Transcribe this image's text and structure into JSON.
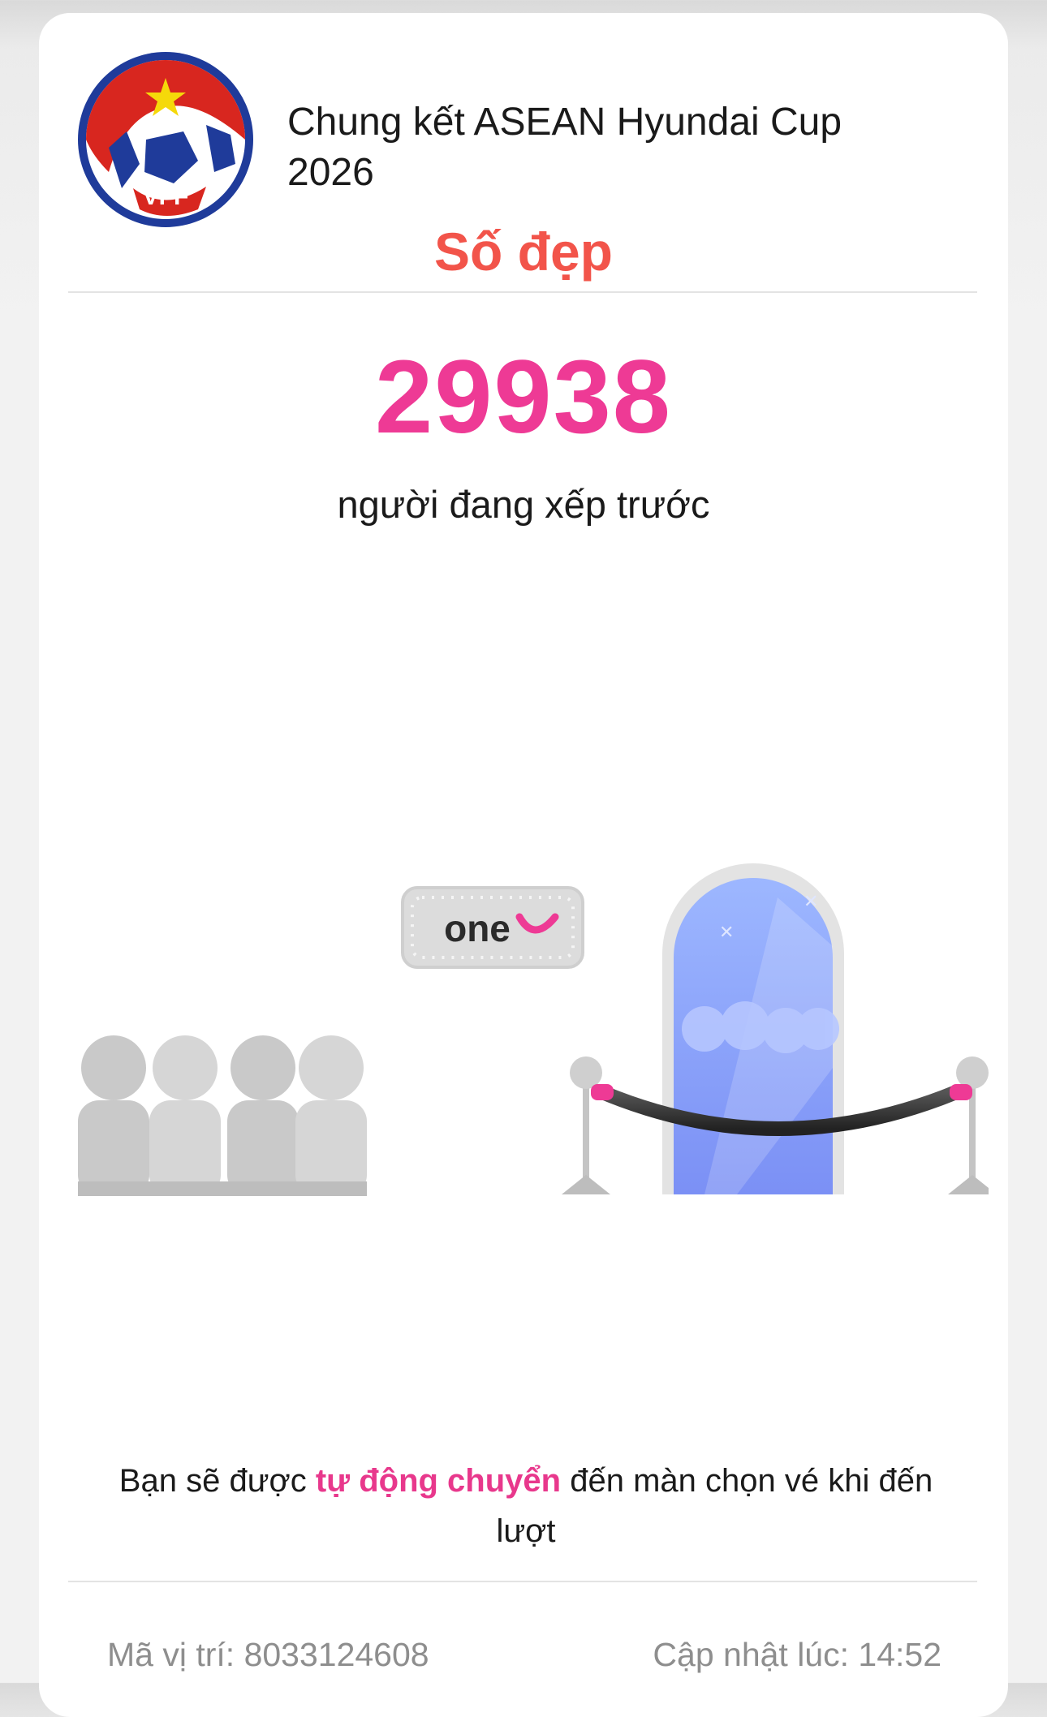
{
  "header": {
    "title": "Chung kết ASEAN Hyundai Cup 2026",
    "subtitle": "Số đẹp",
    "logo_text": "VFF"
  },
  "queue": {
    "ahead_count": "29938",
    "ahead_label": "người đang xếp trước"
  },
  "illustration": {
    "sign_text": "one"
  },
  "notice": {
    "prefix": "Bạn sẽ được ",
    "highlight": "tự động chuyển",
    "suffix": " đến màn chọn vé khi đến lượt"
  },
  "footer": {
    "position_label": "Mã vị trí: 8033124608",
    "updated_label": "Cập nhật lúc: 14:52"
  },
  "colors": {
    "accent_pink": "#ee3a95",
    "subtitle_red": "#f2544a",
    "door_blue": "#8ea4ff"
  }
}
